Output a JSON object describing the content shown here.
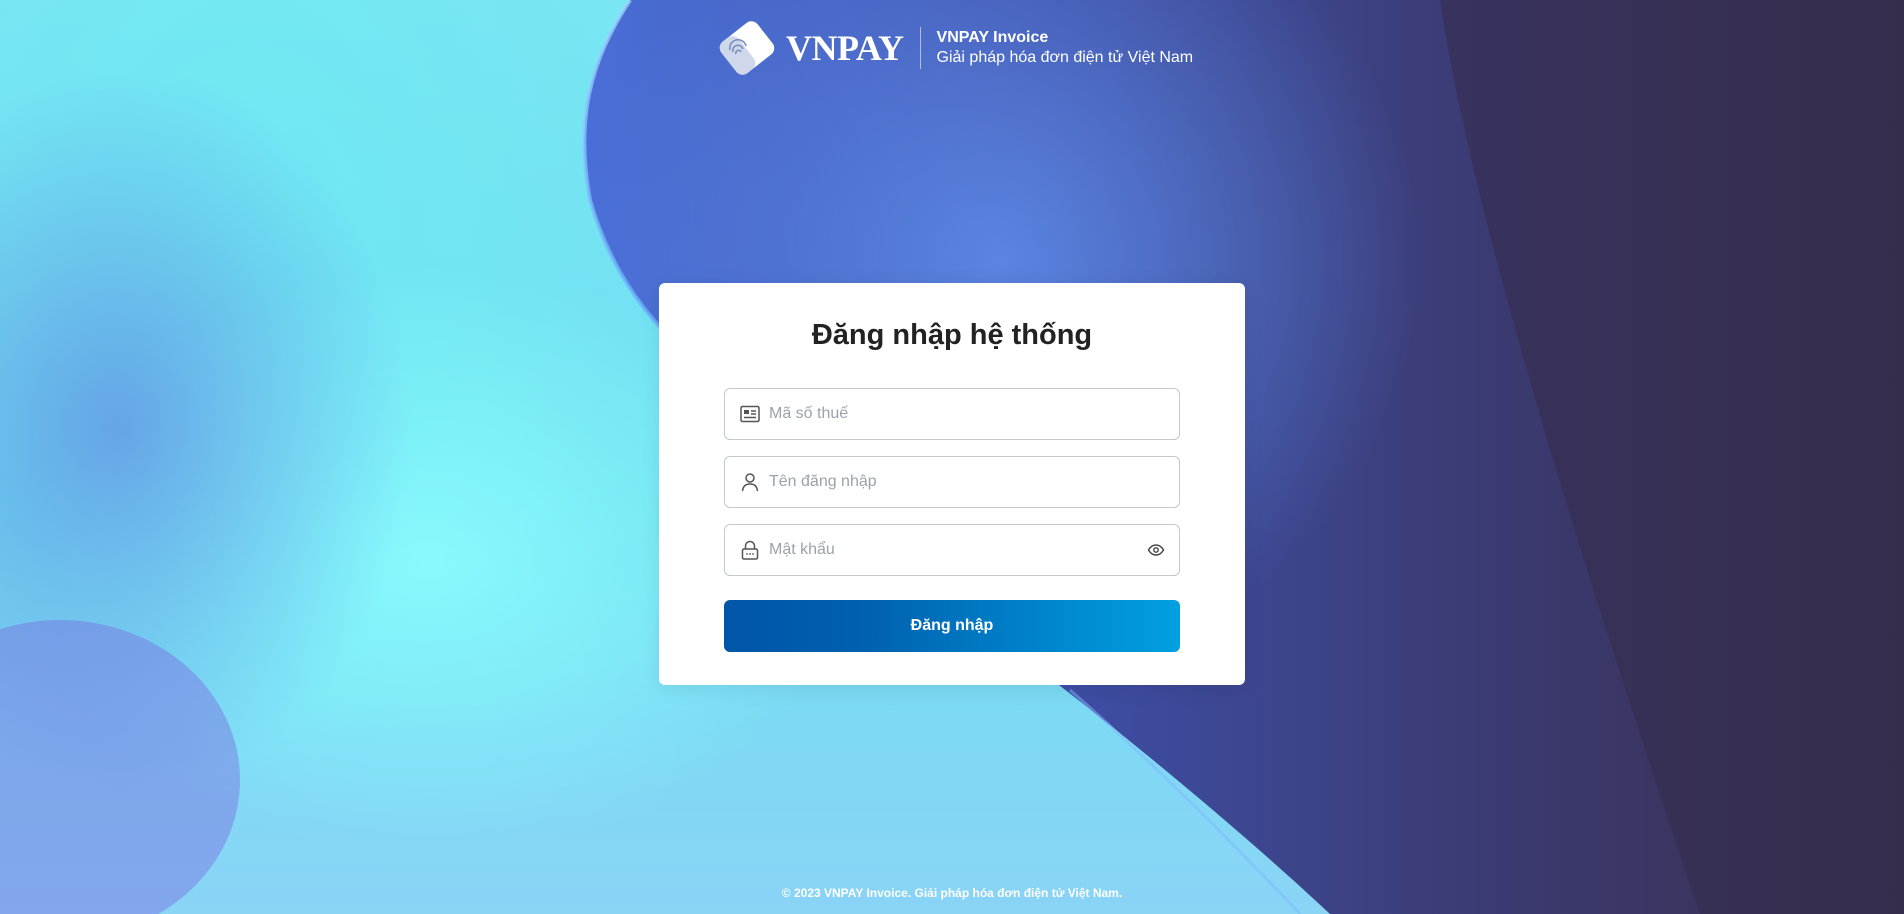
{
  "header": {
    "logo_text": "VNPAY",
    "product_name": "VNPAY Invoice",
    "tagline": "Giải pháp hóa đơn điện tử Việt Nam"
  },
  "login": {
    "title": "Đăng nhập hệ thống",
    "tax_code_placeholder": "Mã số thuế",
    "username_placeholder": "Tên đăng nhập",
    "password_placeholder": "Mật khẩu",
    "submit_label": "Đăng nhập"
  },
  "footer": {
    "copyright": "© 2023 VNPAY Invoice. Giải pháp hóa đơn điện tử Việt Nam."
  },
  "icons": {
    "tax_code": "id-card-icon",
    "username": "user-icon",
    "password": "lock-icon",
    "toggle_password": "eye-icon"
  },
  "colors": {
    "primary": "#0055a8",
    "primary_light": "#00a0e0",
    "background_dark": "#3a3560",
    "background_light": "#74e4f2"
  }
}
